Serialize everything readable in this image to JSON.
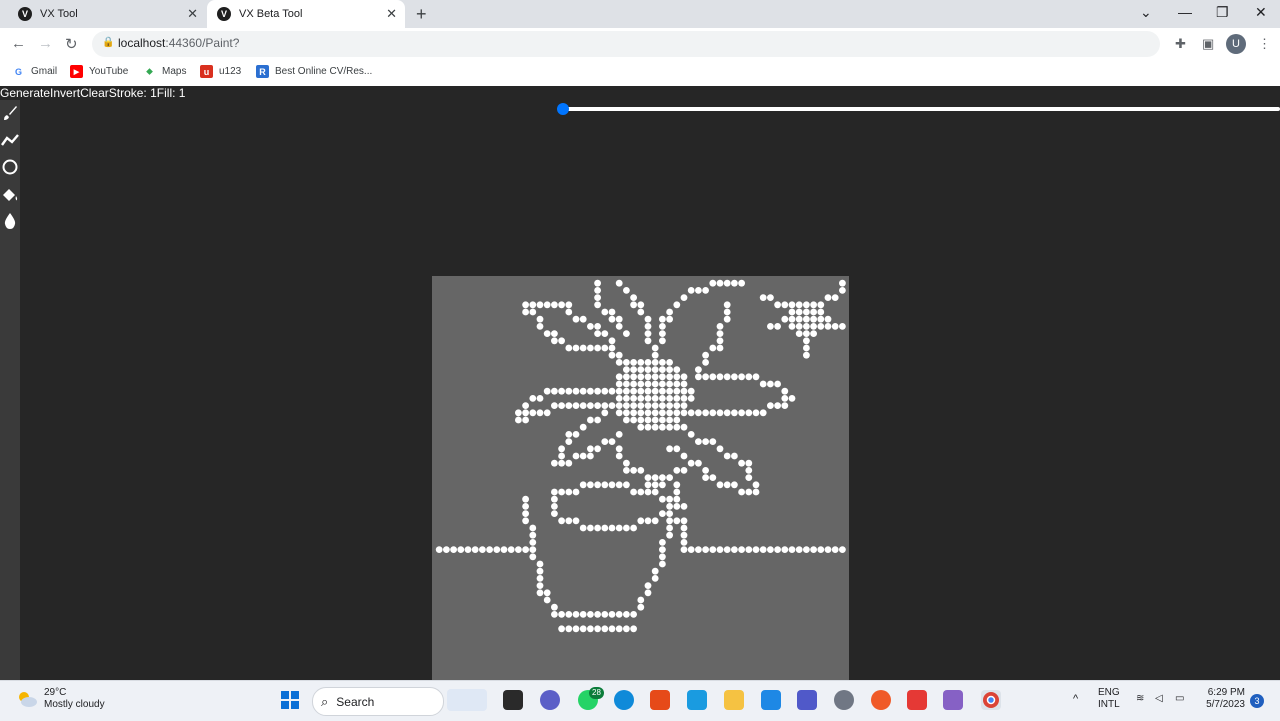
{
  "browser": {
    "tabs": [
      {
        "label": "VX Tool",
        "active": false
      },
      {
        "label": "VX Beta Tool",
        "active": true
      }
    ],
    "address": {
      "host": "localhost",
      "path": ":44360/Paint?"
    },
    "bookmarks": [
      {
        "label": "Gmail",
        "icon": "google-icon"
      },
      {
        "label": "YouTube",
        "icon": "youtube-icon"
      },
      {
        "label": "Maps",
        "icon": "maps-icon"
      },
      {
        "label": "u123",
        "icon": "u123-icon"
      },
      {
        "label": "Best Online CV/Res...",
        "icon": "resume-icon"
      }
    ],
    "profile_initial": "U"
  },
  "app": {
    "menu": {
      "generate": "Generate",
      "invert": "Invert",
      "clear": "Clear",
      "stroke": "Stroke: 1",
      "fill": "Fill: 1"
    },
    "slider_value": 0,
    "tools": [
      {
        "name": "brush-tool",
        "icon": "brush-icon"
      },
      {
        "name": "line-tool",
        "icon": "polyline-icon"
      },
      {
        "name": "circle-tool",
        "icon": "circle-icon"
      },
      {
        "name": "fill-tool",
        "icon": "paint-bucket-icon"
      },
      {
        "name": "dropper-tool",
        "icon": "drop-icon"
      }
    ],
    "colors": {
      "canvas": "#666666",
      "dots": "#ffffff",
      "background": "#262626",
      "slider": "#0075ff"
    }
  },
  "taskbar": {
    "weather": {
      "temp": "29°C",
      "condition": "Mostly cloudy"
    },
    "search_label": "Search",
    "whatsapp_badge": "28",
    "lang": {
      "line1": "ENG",
      "line2": "INTL"
    },
    "clock": {
      "time": "6:29 PM",
      "date": "5/7/2023"
    },
    "notifications": "3"
  }
}
